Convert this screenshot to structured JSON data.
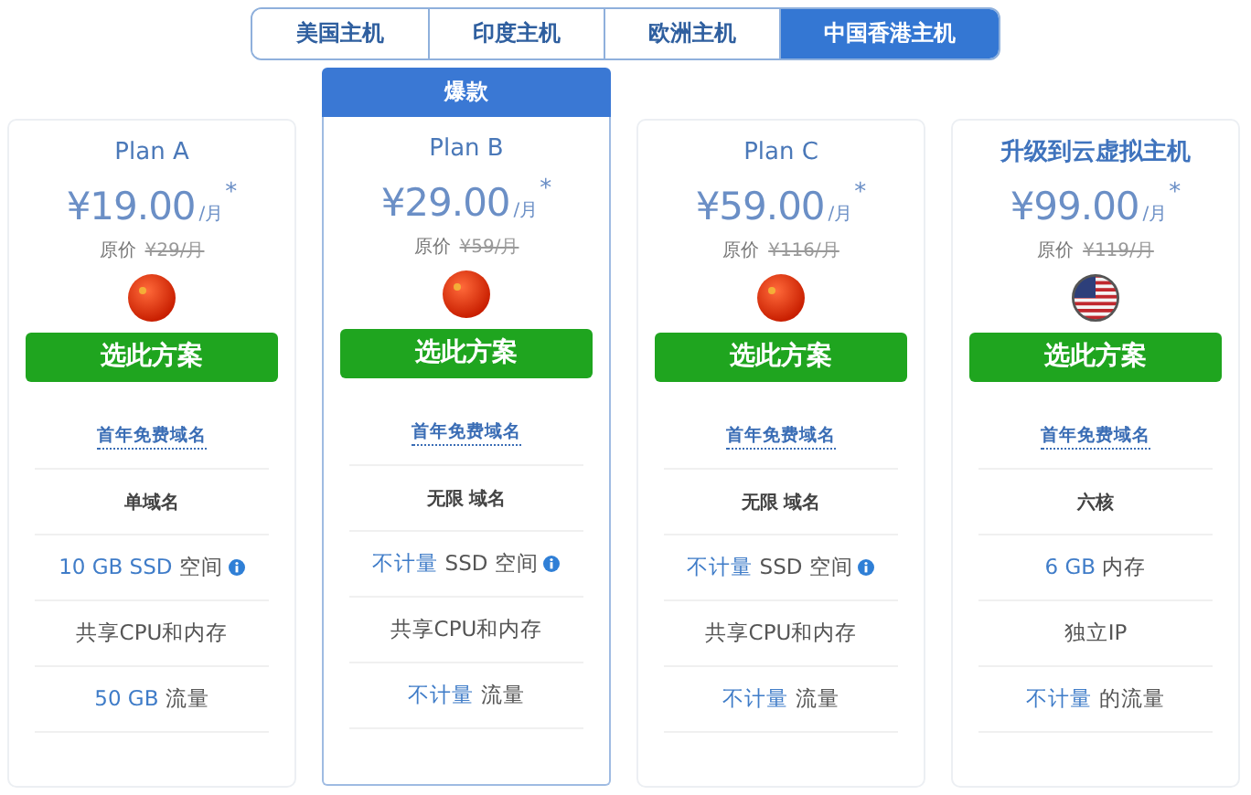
{
  "tabs": [
    {
      "label": "美国主机",
      "selected": false
    },
    {
      "label": "印度主机",
      "selected": false
    },
    {
      "label": "欧洲主机",
      "selected": false
    },
    {
      "label": "中国香港主机",
      "selected": true
    }
  ],
  "plans": [
    {
      "kind": "plan",
      "featured": false,
      "title": "Plan A",
      "price": "¥19.00",
      "unit": "/月",
      "note": "*",
      "original_label": "原价",
      "original_price": "¥29/月",
      "flag": {
        "kind": "china"
      },
      "button": "选此方案",
      "features": [
        {
          "kind": "link",
          "parts": [
            {
              "text": "首年免费域名",
              "accent": false
            }
          ],
          "info": false
        },
        {
          "kind": "bold",
          "parts": [
            {
              "text": "单域名",
              "accent": false
            }
          ],
          "info": false
        },
        {
          "kind": "plain",
          "parts": [
            {
              "text": "10 GB SSD",
              "accent": true
            },
            {
              "text": " 空间",
              "accent": false
            }
          ],
          "info": true
        },
        {
          "kind": "plain",
          "parts": [
            {
              "text": "共享CPU和内存",
              "accent": false
            }
          ],
          "info": false
        },
        {
          "kind": "plain",
          "parts": [
            {
              "text": "50 GB",
              "accent": true
            },
            {
              "text": " 流量",
              "accent": false
            }
          ],
          "info": false
        }
      ]
    },
    {
      "kind": "plan",
      "featured": true,
      "badge": "爆款",
      "title": "Plan B",
      "price": "¥29.00",
      "unit": "/月",
      "note": "*",
      "original_label": "原价",
      "original_price": "¥59/月",
      "flag": {
        "kind": "china"
      },
      "button": "选此方案",
      "features": [
        {
          "kind": "link",
          "parts": [
            {
              "text": "首年免费域名",
              "accent": false
            }
          ],
          "info": false
        },
        {
          "kind": "bold",
          "parts": [
            {
              "text": "无限 域名",
              "accent": false
            }
          ],
          "info": false
        },
        {
          "kind": "plain",
          "parts": [
            {
              "text": "不计量",
              "accent": true
            },
            {
              "text": " SSD 空间",
              "accent": false
            }
          ],
          "info": true
        },
        {
          "kind": "plain",
          "parts": [
            {
              "text": "共享CPU和内存",
              "accent": false
            }
          ],
          "info": false
        },
        {
          "kind": "plain",
          "parts": [
            {
              "text": "不计量",
              "accent": true
            },
            {
              "text": " 流量",
              "accent": false
            }
          ],
          "info": false
        }
      ]
    },
    {
      "kind": "plan",
      "featured": false,
      "title": "Plan C",
      "price": "¥59.00",
      "unit": "/月",
      "note": "*",
      "original_label": "原价",
      "original_price": "¥116/月",
      "flag": {
        "kind": "china"
      },
      "button": "选此方案",
      "features": [
        {
          "kind": "link",
          "parts": [
            {
              "text": "首年免费域名",
              "accent": false
            }
          ],
          "info": false
        },
        {
          "kind": "bold",
          "parts": [
            {
              "text": "无限 域名",
              "accent": false
            }
          ],
          "info": false
        },
        {
          "kind": "plain",
          "parts": [
            {
              "text": "不计量",
              "accent": true
            },
            {
              "text": " SSD 空间",
              "accent": false
            }
          ],
          "info": true
        },
        {
          "kind": "plain",
          "parts": [
            {
              "text": "共享CPU和内存",
              "accent": false
            }
          ],
          "info": false
        },
        {
          "kind": "plain",
          "parts": [
            {
              "text": "不计量",
              "accent": true
            },
            {
              "text": " 流量",
              "accent": false
            }
          ],
          "info": false
        }
      ]
    },
    {
      "kind": "upgrade",
      "featured": false,
      "title": "升级到云虚拟主机",
      "price": "¥99.00",
      "unit": "/月",
      "note": "*",
      "original_label": "原价",
      "original_price": "¥119/月",
      "flag": {
        "kind": "usa"
      },
      "button": "选此方案",
      "features": [
        {
          "kind": "link",
          "parts": [
            {
              "text": "首年免费域名",
              "accent": false
            }
          ],
          "info": false
        },
        {
          "kind": "bold",
          "parts": [
            {
              "text": "六核",
              "accent": false
            }
          ],
          "info": false
        },
        {
          "kind": "plain",
          "parts": [
            {
              "text": "6 GB",
              "accent": true
            },
            {
              "text": " 内存",
              "accent": false
            }
          ],
          "info": false
        },
        {
          "kind": "plain",
          "parts": [
            {
              "text": "独立IP",
              "accent": false
            }
          ],
          "info": false
        },
        {
          "kind": "plain",
          "parts": [
            {
              "text": "不计量",
              "accent": true
            },
            {
              "text": " 的流量",
              "accent": false
            }
          ],
          "info": false
        }
      ]
    }
  ]
}
